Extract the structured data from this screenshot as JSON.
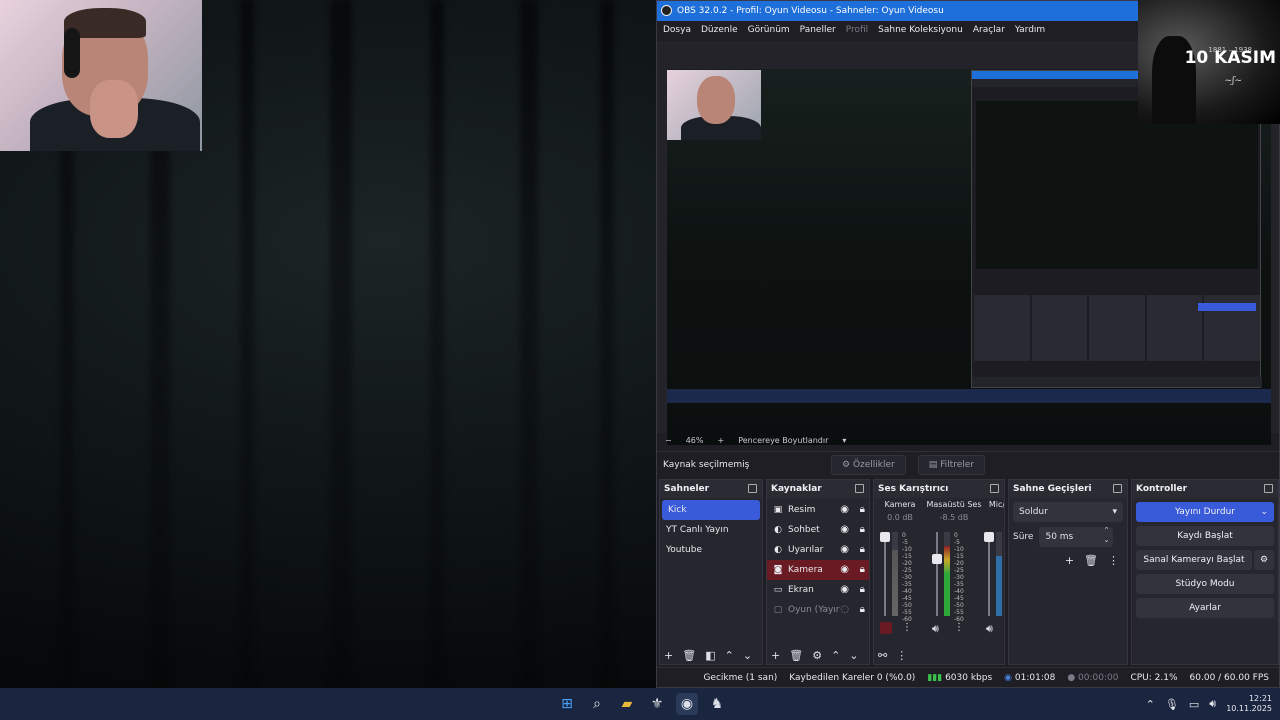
{
  "webcam": {
    "label": "webcam-feed"
  },
  "overlay": {
    "years": "1881 – 1938",
    "title": "10 KASIM",
    "signature": "Signature"
  },
  "obs": {
    "title": "OBS 32.0.2 - Profil: Oyun Videosu - Sahneler: Oyun Videosu",
    "menu": [
      "Dosya",
      "Düzenle",
      "Görünüm",
      "Paneller",
      "Profil",
      "Sahne Koleksiyonu",
      "Araçlar",
      "Yardım"
    ],
    "zoom": {
      "minus": "−",
      "value": "46%",
      "plus": "+",
      "fit": "Pencereye Boyutlandır",
      "caret": "▾"
    },
    "source_bar": {
      "no_source": "Kaynak seçilmemiş",
      "properties": "Özellikler",
      "filters": "Filtreler"
    },
    "scenes": {
      "header": "Sahneler",
      "items": [
        "Kick",
        "YT Canlı Yayın",
        "Youtube"
      ]
    },
    "sources": {
      "header": "Kaynaklar",
      "items": [
        {
          "name": "Resim",
          "icon": "image-icon"
        },
        {
          "name": "Sohbet",
          "icon": "browser-icon"
        },
        {
          "name": "Uyarılar",
          "icon": "browser-icon"
        },
        {
          "name": "Kamera",
          "icon": "camera-icon"
        },
        {
          "name": "Ekran",
          "icon": "monitor-icon"
        },
        {
          "name": "Oyun (Yayır",
          "icon": "window-icon"
        }
      ]
    },
    "mixer": {
      "header": "Ses Karıştırıcı",
      "channels": [
        {
          "name": "Kamera",
          "db": "0.0 dB"
        },
        {
          "name": "Masaüstü Ses",
          "db": "-8.5 dB"
        },
        {
          "name": "Mic/",
          "db": ""
        }
      ],
      "scale": [
        "0",
        "-5",
        "-10",
        "-15",
        "-20",
        "-25",
        "-30",
        "-35",
        "-40",
        "-45",
        "-50",
        "-55",
        "-60"
      ]
    },
    "transitions": {
      "header": "Sahne Geçişleri",
      "type": "Soldur",
      "duration_label": "Süre",
      "duration": "50 ms"
    },
    "controls": {
      "header": "Kontroller",
      "buttons": [
        "Yayını Durdur",
        "Kaydı Başlat",
        "Sanal Kamerayı Başlat",
        "Stüdyo Modu",
        "Ayarlar"
      ]
    },
    "status": {
      "delay": "Gecikme (1 san)",
      "dropped": "Kaybedilen Kareler 0 (%0.0)",
      "bitrate": "6030 kbps",
      "stream_time": "01:01:08",
      "rec_time": "00:00:00",
      "cpu": "CPU: 2.1%",
      "fps": "60.00 / 60.00 FPS"
    }
  },
  "taskbar": {
    "time": "12:21",
    "date": "10.11.2025"
  },
  "colors": {
    "accent": "#3a5bd9",
    "titlebar": "#1e6fd9",
    "taskbar": "#1a2540",
    "live_red": "#6a1a22"
  }
}
